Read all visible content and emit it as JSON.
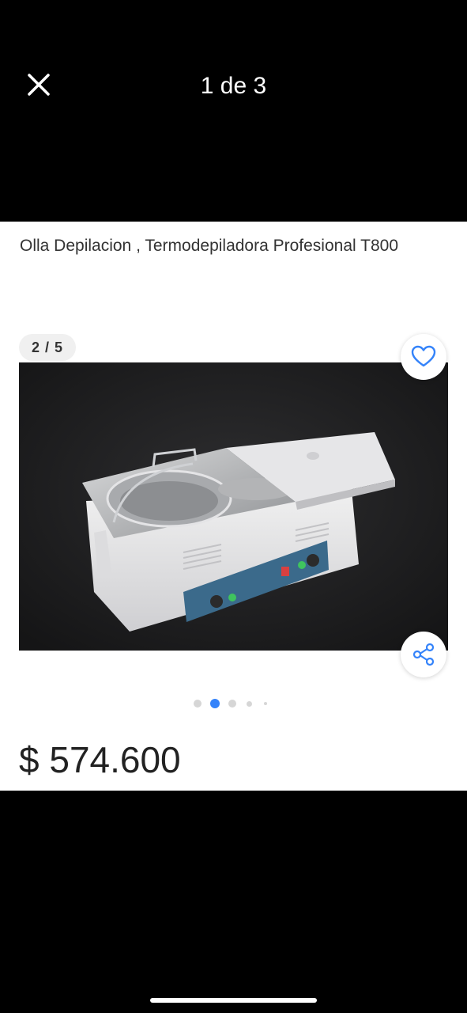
{
  "viewer": {
    "counter": "1 de 3",
    "close_icon": "close-icon"
  },
  "listing": {
    "title": "Olla Depilacion , Termodepiladora Profesional T800",
    "image_counter": "2 / 5",
    "price": "$ 574.600",
    "carousel": {
      "total_dots": 5,
      "active_index": 1
    },
    "icons": {
      "favorite": "heart-icon",
      "share": "share-icon"
    },
    "colors": {
      "accent": "#3483fa",
      "text": "#333333",
      "image_background": "#1d1d1e"
    }
  }
}
